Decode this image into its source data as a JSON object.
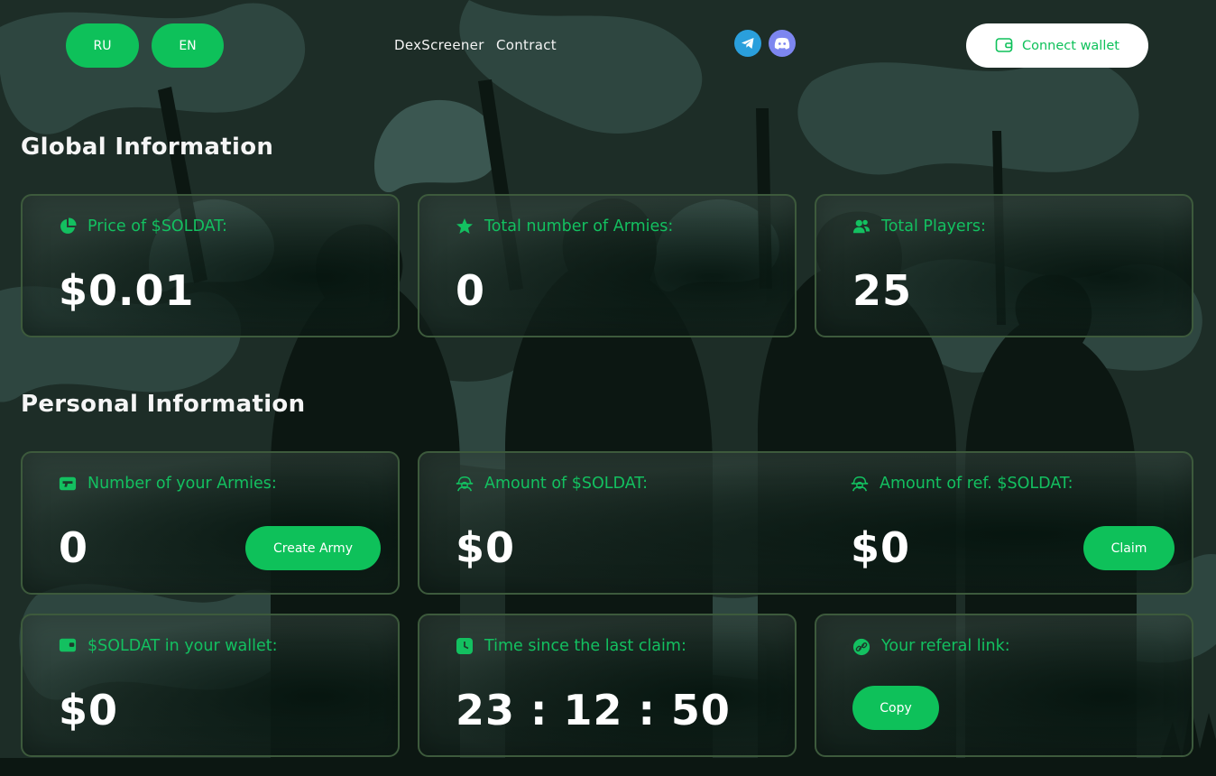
{
  "header": {
    "languages": [
      "RU",
      "EN"
    ],
    "links": [
      "DexScreener",
      "Contract"
    ],
    "socials": [
      "telegram-icon",
      "discord-icon"
    ],
    "connect_label": "Connect wallet"
  },
  "global": {
    "title": "Global Information",
    "cards": [
      {
        "label": "Price of $SOLDAT:",
        "value": "$0.01",
        "icon": "pie-chart-icon"
      },
      {
        "label": "Total number of Armies:",
        "value": "0",
        "icon": "star-icon"
      },
      {
        "label": "Total Players:",
        "value": "25",
        "icon": "users-icon"
      }
    ]
  },
  "personal": {
    "title": "Personal Information",
    "armies": {
      "label": "Number of your Armies:",
      "value": "0",
      "button": "Create Army",
      "icon": "gun-icon"
    },
    "amount": {
      "label": "Amount of $SOLDAT:",
      "value": "$0",
      "icon": "soldier-icon"
    },
    "ref_amount": {
      "label": "Amount of ref. $SOLDAT:",
      "value": "$0",
      "button": "Claim",
      "icon": "soldier-icon"
    },
    "wallet": {
      "label": "$SOLDAT in your wallet:",
      "value": "$0",
      "icon": "wallet-icon"
    },
    "time": {
      "label": "Time since the last claim:",
      "value": "23 : 12 : 50",
      "icon": "clock-icon"
    },
    "referal": {
      "label": "Your referal link:",
      "button": "Copy",
      "icon": "link-icon"
    }
  },
  "colors": {
    "accent": "#0ec15a",
    "label_green": "#13c060",
    "border": "#3d5a3c"
  }
}
